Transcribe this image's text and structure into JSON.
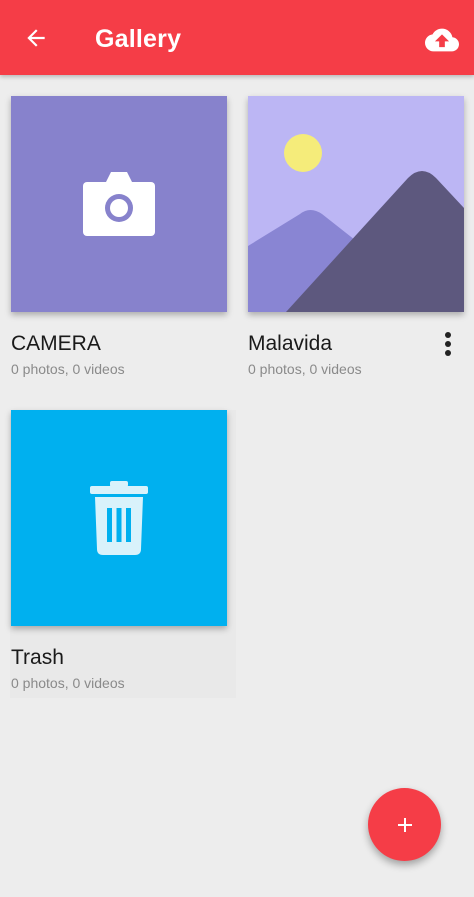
{
  "app_bar": {
    "title": "Gallery",
    "back_icon": "arrow-back-icon",
    "upload_icon": "cloud-upload-icon",
    "background_color": "#f53d47"
  },
  "albums": [
    {
      "name": "CAMERA",
      "count": "0 photos, 0 videos",
      "thumbnail_icon": "camera-icon",
      "thumbnail_color": "#8782cc"
    },
    {
      "name": "Malavida",
      "count": "0 photos, 0 videos",
      "thumbnail_icon": "landscape-placeholder-icon",
      "thumbnail_color": "#bcb6f4",
      "has_more_menu": true,
      "more_icon": "more-vert-icon"
    },
    {
      "name": "Trash",
      "count": "0 photos, 0 videos",
      "thumbnail_icon": "trash-icon",
      "thumbnail_color": "#00b0ef"
    }
  ],
  "fab": {
    "icon": "add-icon",
    "color": "#f53d47"
  }
}
